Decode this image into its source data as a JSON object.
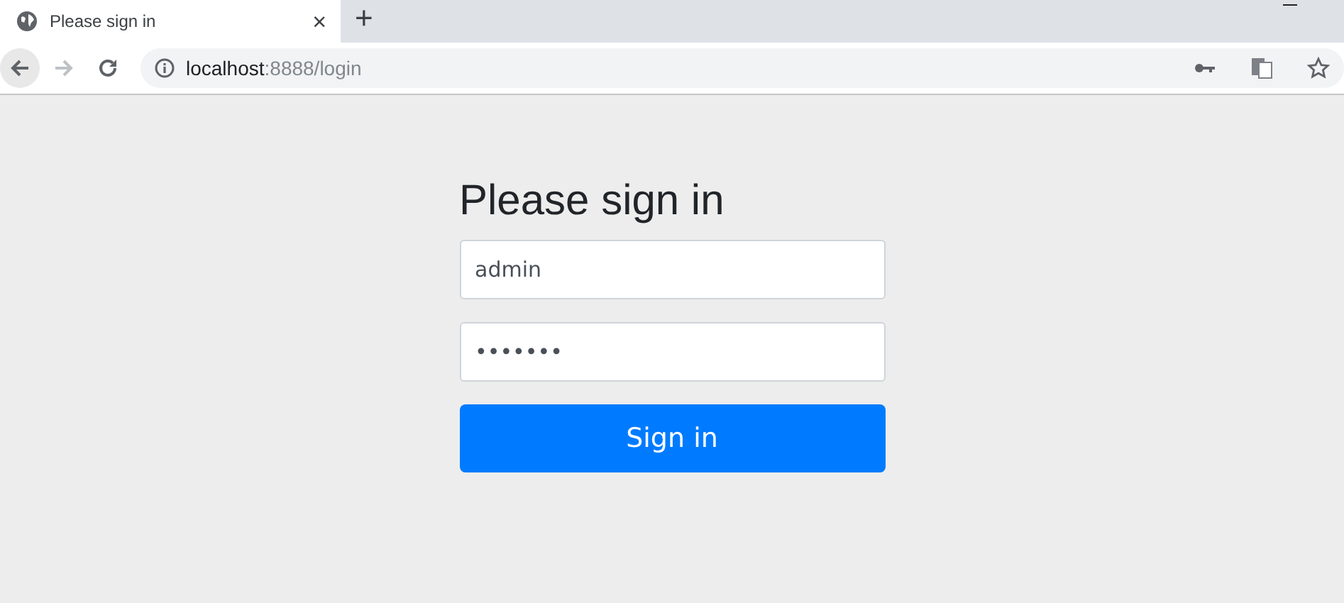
{
  "browser": {
    "tab": {
      "title": "Please sign in",
      "close": "×",
      "new_tab": "+"
    },
    "address": {
      "host": "localhost",
      "path": ":8888/login"
    }
  },
  "form": {
    "heading": "Please sign in",
    "username": {
      "value": "admin"
    },
    "password": {
      "value": "•••••••"
    },
    "button": "Sign in"
  }
}
